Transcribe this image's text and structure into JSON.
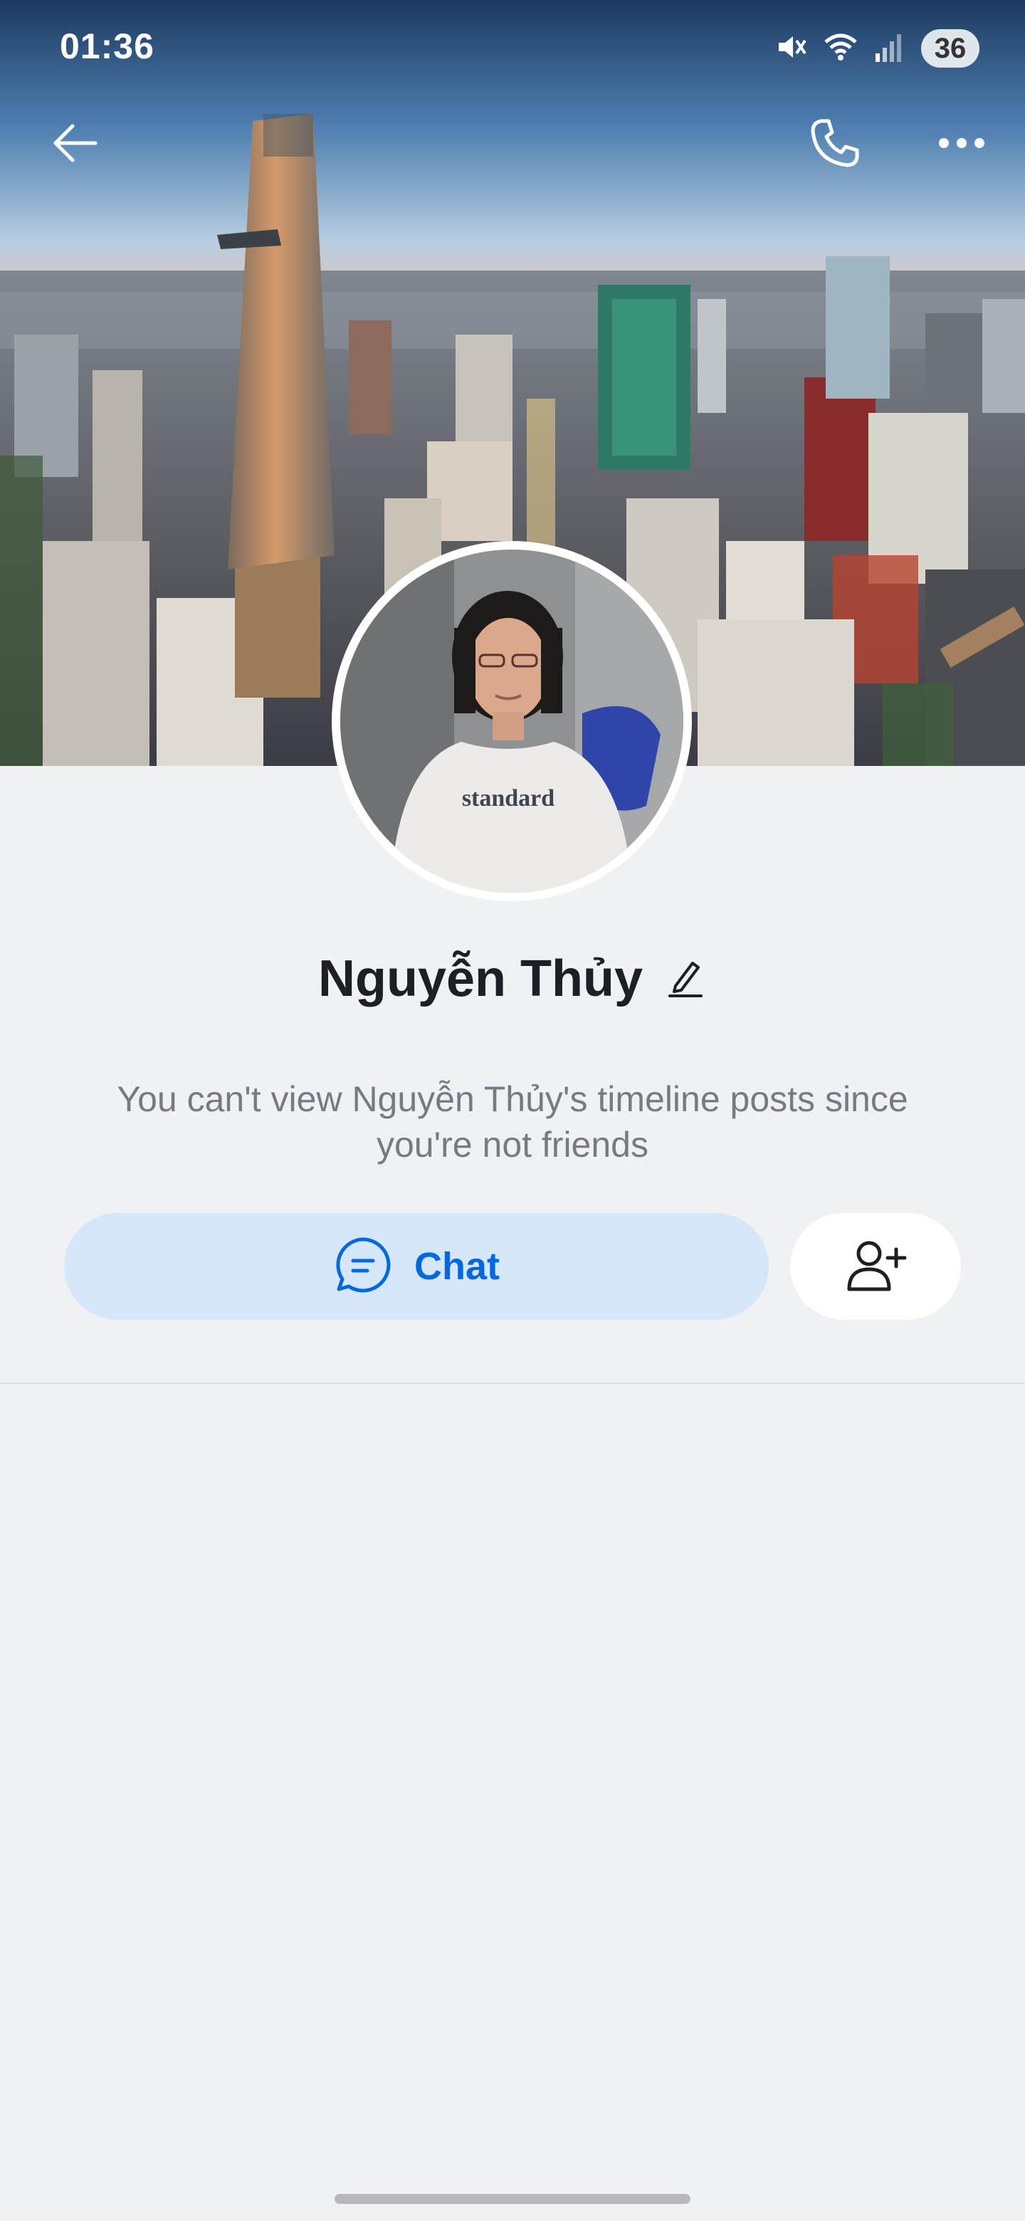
{
  "status_bar": {
    "time": "01:36",
    "battery_level": "36",
    "icons": [
      "mute-icon",
      "wifi-icon",
      "signal-icon",
      "battery-icon"
    ]
  },
  "nav": {
    "back_icon": "arrow-left-icon",
    "call_icon": "phone-icon",
    "more_icon": "more-dots-icon"
  },
  "profile": {
    "name": "Nguyễn Thủy",
    "avatar_shirt_text": "standard",
    "notice_line1": "You can't view Nguyễn Thủy's timeline posts since",
    "notice_line2": "you're not friends"
  },
  "actions": {
    "chat_label": "Chat",
    "add_friend_icon": "add-user-icon"
  },
  "colors": {
    "background": "#f0f1f5",
    "chat_button_bg": "#d7e7fb",
    "accent": "#0068e0",
    "name_text": "#1c1f24",
    "notice_text": "#777b80"
  }
}
